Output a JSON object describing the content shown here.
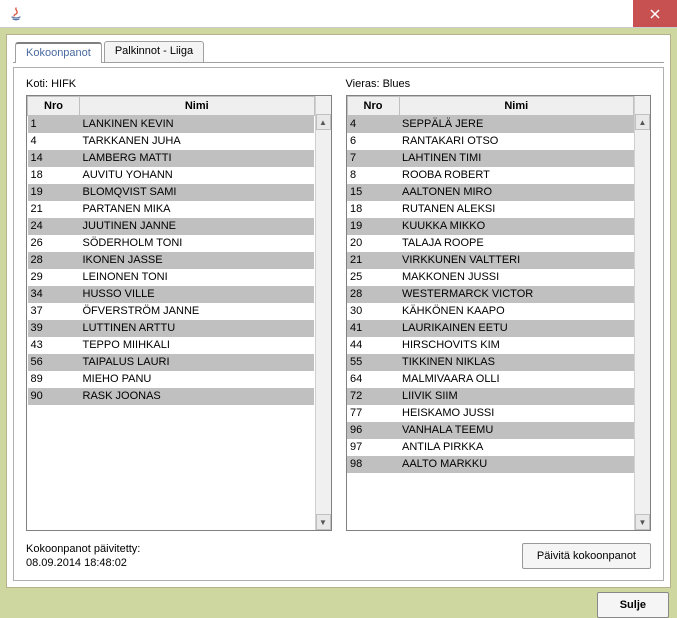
{
  "titlebar": {
    "close_aria": "Close"
  },
  "tabs": {
    "kokoonpanot": "Kokoonpanot",
    "palkinnot": "Palkinnot - Liiga"
  },
  "home": {
    "label": "Koti: HIFK",
    "headers": {
      "nro": "Nro",
      "nimi": "Nimi"
    },
    "rows": [
      {
        "nro": "1",
        "nimi": "LANKINEN KEVIN",
        "shade": true
      },
      {
        "nro": "4",
        "nimi": "TARKKANEN JUHA",
        "shade": false
      },
      {
        "nro": "14",
        "nimi": "LAMBERG MATTI",
        "shade": true
      },
      {
        "nro": "18",
        "nimi": "AUVITU YOHANN",
        "shade": false
      },
      {
        "nro": "19",
        "nimi": "BLOMQVIST SAMI",
        "shade": true
      },
      {
        "nro": "21",
        "nimi": "PARTANEN MIKA",
        "shade": false
      },
      {
        "nro": "24",
        "nimi": "JUUTINEN JANNE",
        "shade": true
      },
      {
        "nro": "26",
        "nimi": "SÖDERHOLM TONI",
        "shade": false
      },
      {
        "nro": "28",
        "nimi": "IKONEN JASSE",
        "shade": true
      },
      {
        "nro": "29",
        "nimi": "LEINONEN TONI",
        "shade": false
      },
      {
        "nro": "34",
        "nimi": "HUSSO VILLE",
        "shade": true
      },
      {
        "nro": "37",
        "nimi": "ÖFVERSTRÖM JANNE",
        "shade": false
      },
      {
        "nro": "39",
        "nimi": "LUTTINEN ARTTU",
        "shade": true
      },
      {
        "nro": "43",
        "nimi": "TEPPO MIIHKALI",
        "shade": false
      },
      {
        "nro": "56",
        "nimi": "TAIPALUS LAURI",
        "shade": true
      },
      {
        "nro": "89",
        "nimi": "MIEHO PANU",
        "shade": false
      },
      {
        "nro": "90",
        "nimi": "RASK JOONAS",
        "shade": true
      }
    ]
  },
  "away": {
    "label": "Vieras: Blues",
    "headers": {
      "nro": "Nro",
      "nimi": "Nimi"
    },
    "rows": [
      {
        "nro": "4",
        "nimi": "SEPPÄLÄ JERE",
        "shade": true
      },
      {
        "nro": "6",
        "nimi": "RANTAKARI OTSO",
        "shade": false
      },
      {
        "nro": "7",
        "nimi": "LAHTINEN TIMI",
        "shade": true
      },
      {
        "nro": "8",
        "nimi": "ROOBA ROBERT",
        "shade": false
      },
      {
        "nro": "15",
        "nimi": "AALTONEN MIRO",
        "shade": true
      },
      {
        "nro": "18",
        "nimi": "RUTANEN ALEKSI",
        "shade": false
      },
      {
        "nro": "19",
        "nimi": "KUUKKA MIKKO",
        "shade": true
      },
      {
        "nro": "20",
        "nimi": "TALAJA ROOPE",
        "shade": false
      },
      {
        "nro": "21",
        "nimi": "VIRKKUNEN VALTTERI",
        "shade": true
      },
      {
        "nro": "25",
        "nimi": "MAKKONEN JUSSI",
        "shade": false
      },
      {
        "nro": "28",
        "nimi": "WESTERMARCK VICTOR",
        "shade": true
      },
      {
        "nro": "30",
        "nimi": "KÄHKÖNEN KAAPO",
        "shade": false
      },
      {
        "nro": "41",
        "nimi": "LAURIKAINEN EETU",
        "shade": true
      },
      {
        "nro": "44",
        "nimi": "HIRSCHOVITS KIM",
        "shade": false
      },
      {
        "nro": "55",
        "nimi": "TIKKINEN NIKLAS",
        "shade": true
      },
      {
        "nro": "64",
        "nimi": "MALMIVAARA OLLI",
        "shade": false
      },
      {
        "nro": "72",
        "nimi": "LIIVIK SIIM",
        "shade": true
      },
      {
        "nro": "77",
        "nimi": "HEISKAMO JUSSI",
        "shade": false
      },
      {
        "nro": "96",
        "nimi": "VANHALA TEEMU",
        "shade": true
      },
      {
        "nro": "97",
        "nimi": "ANTILA PIRKKA",
        "shade": false
      },
      {
        "nro": "98",
        "nimi": "AALTO MARKKU",
        "shade": true
      }
    ]
  },
  "footer": {
    "updated_label": "Kokoonpanot päivitetty:",
    "updated_time": "08.09.2014 18:48:02",
    "update_button": "Päivitä kokoonpanot"
  },
  "close_button": "Sulje"
}
